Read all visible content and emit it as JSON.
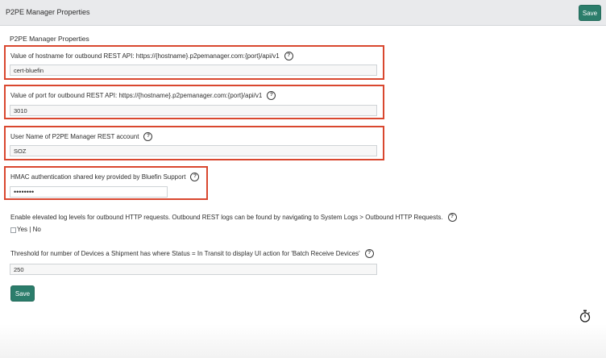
{
  "header": {
    "title": "P2PE Manager Properties",
    "save_label": "Save"
  },
  "section": {
    "title": "P2PE Manager Properties"
  },
  "properties": [
    {
      "label": "Value of hostname for outbound REST API: https://{hostname}.p2pemanager.com:{port}/api/v1",
      "value": "cert-bluefin"
    },
    {
      "label": "Value of port for outbound REST API: https://{hostname}.p2pemanager.com:{port}/api/v1",
      "value": "3010"
    },
    {
      "label": "User Name of P2PE Manager REST account",
      "value": "SOZ"
    },
    {
      "label": "HMAC authentication shared key provided by Bluefin Support",
      "value": "••••••••"
    },
    {
      "label": "Enable elevated log levels for outbound HTTP requests. Outbound REST logs can be found by navigating to System Logs > Outbound HTTP Requests.",
      "options": "Yes | No"
    },
    {
      "label": "Threshold for number of Devices a Shipment has where Status = In Transit to display UI action for 'Batch Receive Devices'",
      "value": "250"
    }
  ],
  "footer": {
    "save_label": "Save"
  },
  "icons": {
    "help": "question-circle-icon",
    "stopwatch": "stopwatch-icon"
  },
  "colors": {
    "highlight": "#d9472f",
    "button": "#2b7d6b",
    "header_bg": "#e9eaec"
  }
}
